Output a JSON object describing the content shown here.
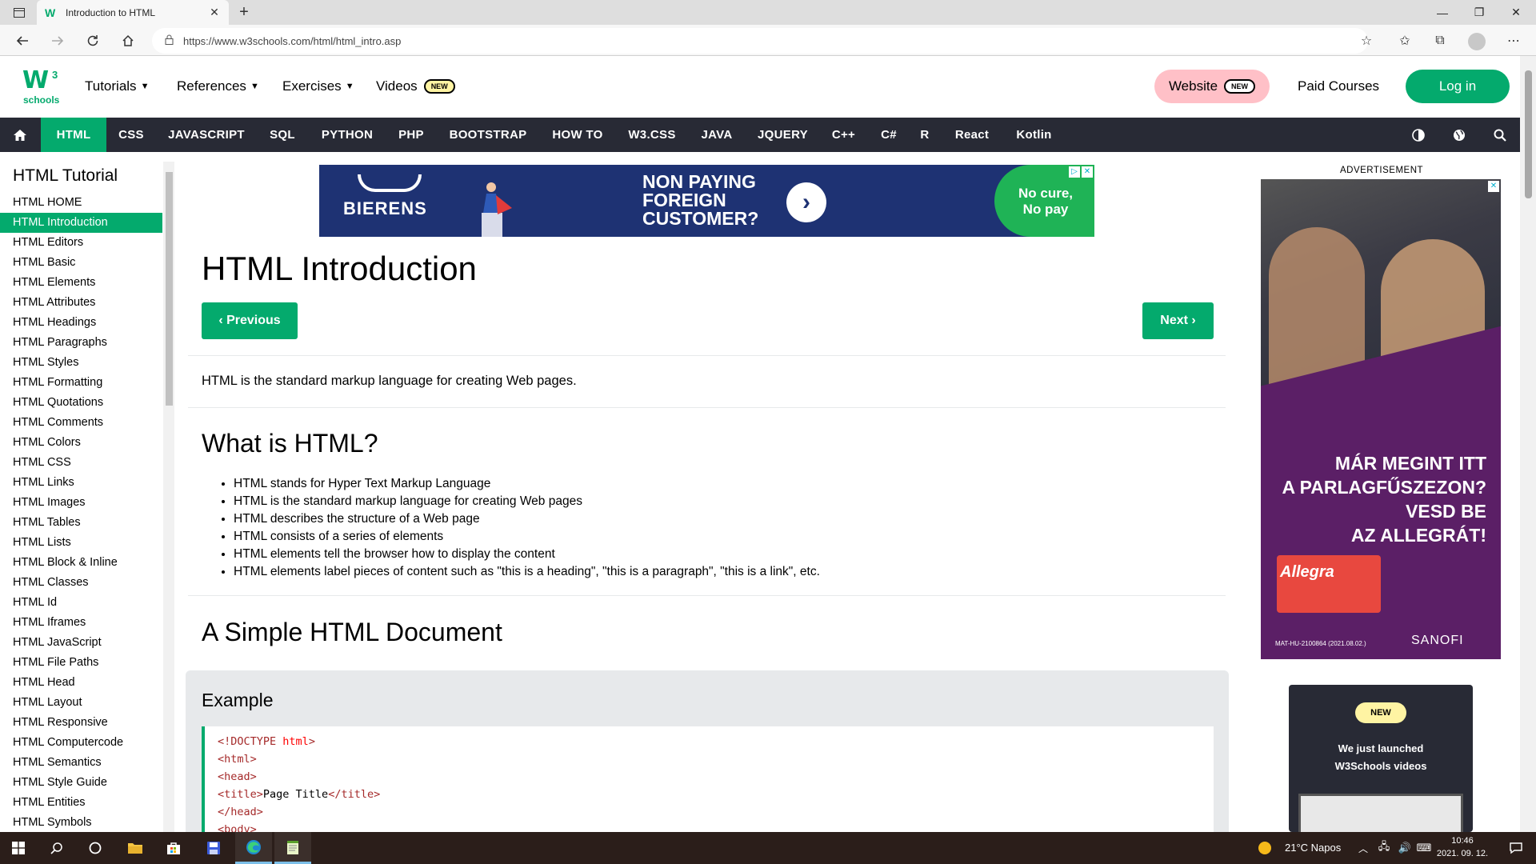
{
  "browser": {
    "tab_title": "Introduction to HTML",
    "url": "https://www.w3schools.com/html/html_intro.asp"
  },
  "topnav": {
    "logo_sup": "3",
    "logo_text": "schools",
    "tutorials": "Tutorials",
    "references": "References",
    "exercises": "Exercises",
    "videos": "Videos",
    "new_badge": "NEW",
    "website": "Website",
    "paid_courses": "Paid Courses",
    "login": "Log in"
  },
  "subnav": {
    "items": [
      "HTML",
      "CSS",
      "JAVASCRIPT",
      "SQL",
      "PYTHON",
      "PHP",
      "BOOTSTRAP",
      "HOW TO",
      "W3.CSS",
      "JAVA",
      "JQUERY",
      "C++",
      "C#",
      "R",
      "React",
      "Kotlin"
    ]
  },
  "sidebar": {
    "title": "HTML Tutorial",
    "items": [
      "HTML HOME",
      "HTML Introduction",
      "HTML Editors",
      "HTML Basic",
      "HTML Elements",
      "HTML Attributes",
      "HTML Headings",
      "HTML Paragraphs",
      "HTML Styles",
      "HTML Formatting",
      "HTML Quotations",
      "HTML Comments",
      "HTML Colors",
      "HTML CSS",
      "HTML Links",
      "HTML Images",
      "HTML Tables",
      "HTML Lists",
      "HTML Block & Inline",
      "HTML Classes",
      "HTML Id",
      "HTML Iframes",
      "HTML JavaScript",
      "HTML File Paths",
      "HTML Head",
      "HTML Layout",
      "HTML Responsive",
      "HTML Computercode",
      "HTML Semantics",
      "HTML Style Guide",
      "HTML Entities",
      "HTML Symbols"
    ]
  },
  "ad_top": {
    "brand": "BIERENS",
    "headline_1": "NON PAYING",
    "headline_2": "FOREIGN",
    "headline_3": "CUSTOMER?",
    "cta_1": "No cure,",
    "cta_2": "No pay"
  },
  "main": {
    "title": "HTML Introduction",
    "previous": "Previous",
    "next": "Next",
    "intro": "HTML is the standard markup language for creating Web pages.",
    "whatis_heading": "What is HTML?",
    "whatis_items": [
      "HTML stands for Hyper Text Markup Language",
      "HTML is the standard markup language for creating Web pages",
      "HTML describes the structure of a Web page",
      "HTML consists of a series of elements",
      "HTML elements tell the browser how to display the content",
      "HTML elements label pieces of content such as \"this is a heading\", \"this is a paragraph\", \"this is a link\", etc."
    ],
    "simple_heading": "A Simple HTML Document",
    "example_heading": "Example"
  },
  "ads_right": {
    "label": "ADVERTISEMENT",
    "headline_1": "MÁR MEGINT ITT",
    "headline_2": "A PARLAGFŰSZEZON?",
    "headline_3": "VESD BE",
    "headline_4": "AZ ALLEGRÁT!",
    "product": "Allegra",
    "code": "MAT-HU-2100864 (2021.08.02.)",
    "sponsor": "SANOFI",
    "video_new": "NEW",
    "video_line1": "We just launched",
    "video_line2": "W3Schools videos"
  },
  "taskbar": {
    "weather": "21°C  Napos",
    "time": "10:46",
    "date": "2021. 09. 12."
  },
  "colors": {
    "accent": "#04AA6D",
    "subnav_bg": "#282A35",
    "new_badge": "#fff4a3",
    "website_button": "#ffc0c7"
  }
}
